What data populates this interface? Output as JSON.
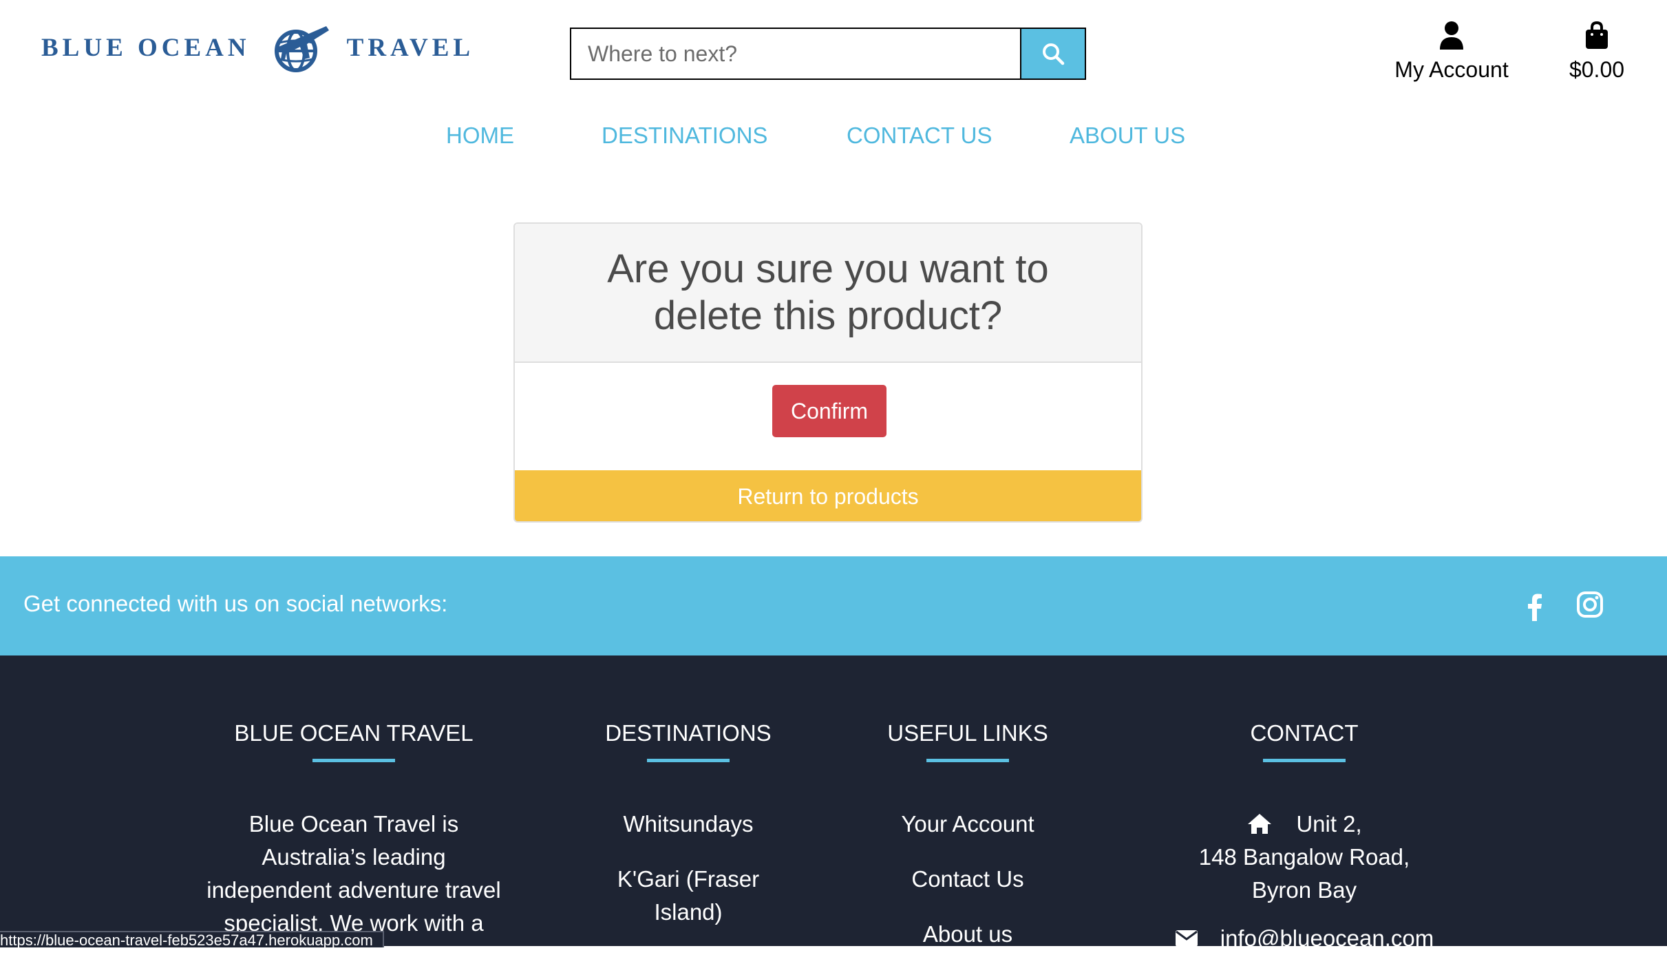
{
  "header": {
    "logo_left": "BLUE OCEAN",
    "logo_right": "TRAVEL",
    "logo_icon": "globe-plane-icon",
    "search_placeholder": "Where to next?",
    "search_icon": "search-icon",
    "account_label": "My Account",
    "account_icon": "user-icon",
    "bag_label": "$0.00",
    "bag_icon": "shopping-bag-icon"
  },
  "nav": {
    "items": [
      {
        "label": "HOME"
      },
      {
        "label": "DESTINATIONS"
      },
      {
        "label": "CONTACT US"
      },
      {
        "label": "ABOUT US"
      }
    ]
  },
  "dialog": {
    "title": "Are you sure you want to delete this product?",
    "confirm_label": "Confirm",
    "return_label": "Return to products"
  },
  "social": {
    "text": "Get connected with us on social networks:",
    "icons": [
      "facebook-icon",
      "instagram-icon"
    ]
  },
  "footer": {
    "about": {
      "heading": "BLUE OCEAN TRAVEL",
      "lines": [
        "Blue Ocean Travel is",
        "Australia’s leading",
        "independent adventure travel",
        "specialist. We work with a"
      ]
    },
    "destinations": {
      "heading": "DESTINATIONS",
      "items": [
        "Whitsundays",
        "K'Gari (Fraser",
        "Island)"
      ]
    },
    "useful_links": {
      "heading": "USEFUL LINKS",
      "items": [
        "Your Account",
        "Contact Us",
        "About us"
      ]
    },
    "contact": {
      "heading": "CONTACT",
      "address": [
        "Unit 2,",
        "148 Bangalow Road,",
        "Byron Bay"
      ],
      "email": "info@blueocean.com",
      "home_icon": "home-icon",
      "email_icon": "envelope-icon"
    }
  },
  "status_url": "https://blue-ocean-travel-feb523e57a47.herokuapp.com",
  "colors": {
    "accent": "#5bc0e2",
    "brand": "#2a5c96",
    "danger": "#d0424a",
    "warning": "#f5c242",
    "footer": "#1e2433"
  }
}
